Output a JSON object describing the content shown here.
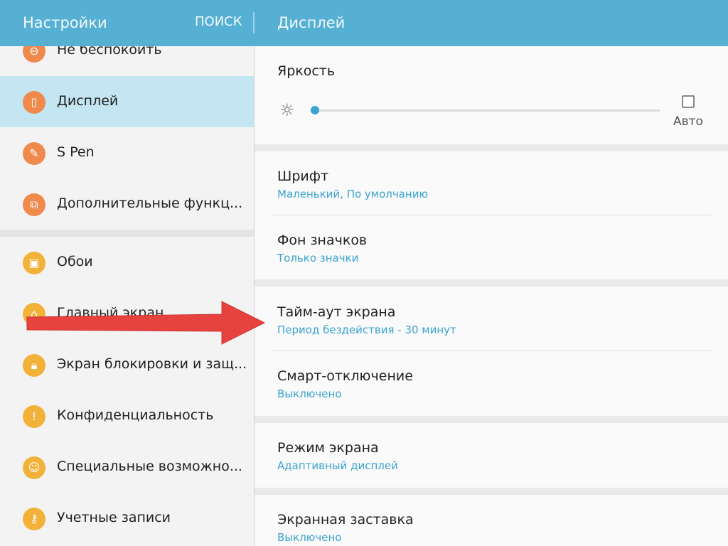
{
  "header": {
    "app_title": "Настройки",
    "search_label": "ПОИСК",
    "page_title": "Дисплей"
  },
  "sidebar": {
    "items": [
      {
        "label": "Не беспокоить",
        "icon": "do-not-disturb-icon",
        "color": "#ef8a4c"
      },
      {
        "label": "Дисплей",
        "icon": "display-icon",
        "color": "#ef8a4c"
      },
      {
        "label": "S Pen",
        "icon": "pen-icon",
        "color": "#ef8a4c"
      },
      {
        "label": "Дополнительные функц...",
        "icon": "advanced-features-icon",
        "color": "#ef8a4c"
      },
      {
        "label": "Обои",
        "icon": "wallpaper-icon",
        "color": "#f2b23a"
      },
      {
        "label": "Главный экран",
        "icon": "home-icon",
        "color": "#f2b23a"
      },
      {
        "label": "Экран блокировки и защ...",
        "icon": "lock-icon",
        "color": "#f2b23a"
      },
      {
        "label": "Конфиденциальность",
        "icon": "privacy-icon",
        "color": "#f2b23a"
      },
      {
        "label": "Специальные возможно...",
        "icon": "accessibility-icon",
        "color": "#f2b23a"
      },
      {
        "label": "Учетные записи",
        "icon": "key-icon",
        "color": "#f2b23a"
      }
    ],
    "active_color": "#c3e6f2"
  },
  "content": {
    "brightness": {
      "title": "Яркость",
      "auto_label": "Авто",
      "level": 0.01,
      "auto_checked": false
    },
    "rows": [
      {
        "title": "Шрифт",
        "subtitle": "Маленький, По умолчанию"
      },
      {
        "title": "Фон значков",
        "subtitle": "Только значки"
      },
      {
        "title": "Тайм-аут экрана",
        "subtitle": "Период бездействия - 30 минут"
      },
      {
        "title": "Смарт-отключение",
        "subtitle": "Выключено"
      },
      {
        "title": "Режим экрана",
        "subtitle": "Адаптивный дисплей"
      },
      {
        "title": "Экранная заставка",
        "subtitle": "Выключено"
      }
    ]
  },
  "colors": {
    "header": "#55b0d4",
    "accent": "#3aa3cf",
    "annotation_arrow": "#e8423f"
  }
}
